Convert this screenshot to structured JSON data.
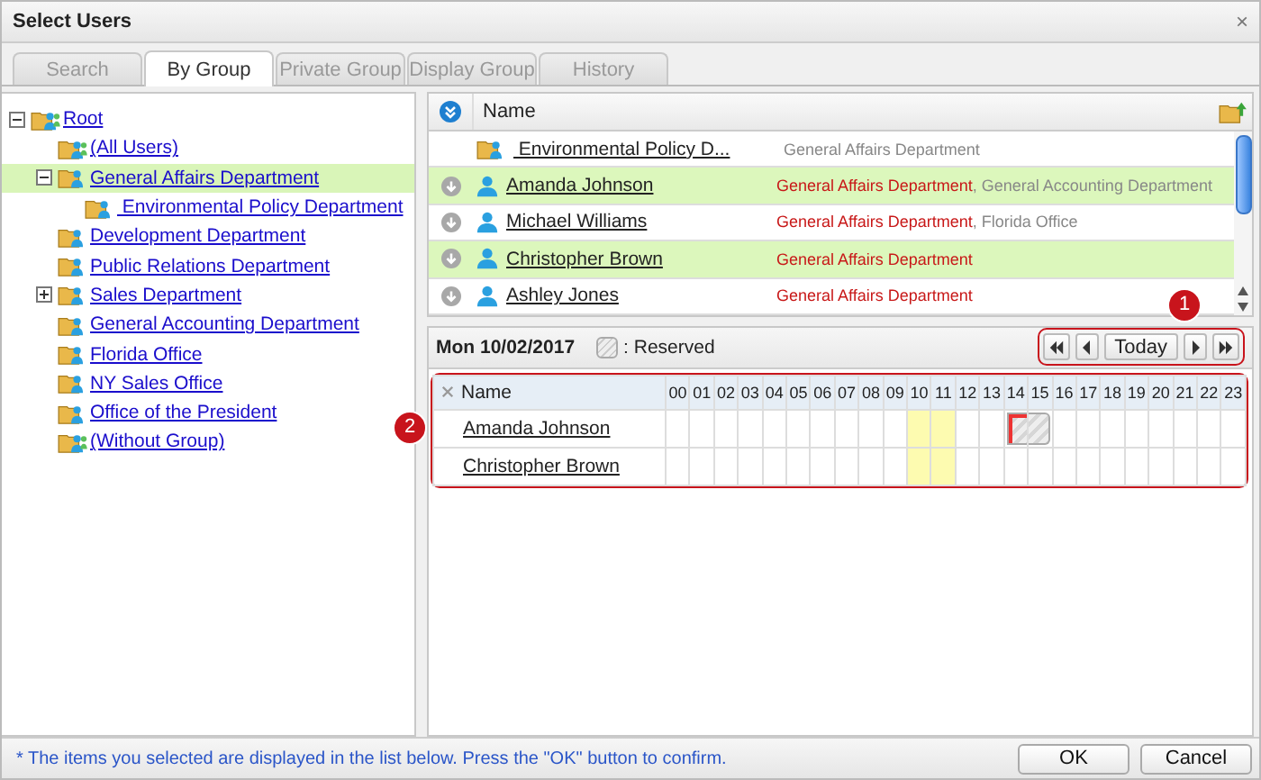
{
  "window": {
    "title": "Select Users",
    "close": "×"
  },
  "tabs": [
    {
      "label": "Search",
      "selected": false
    },
    {
      "label": "By Group",
      "selected": true
    },
    {
      "label": "Private Group",
      "selected": false
    },
    {
      "label": "Display Group",
      "selected": false
    },
    {
      "label": "History",
      "selected": false
    }
  ],
  "tree": [
    {
      "label": "Root",
      "kind": "all",
      "selected": false,
      "expanded": true,
      "children": [
        {
          "label": "(All Users)",
          "kind": "all",
          "selected": false
        },
        {
          "label": "General Affairs Department",
          "kind": "dept",
          "selected": true,
          "expanded": true,
          "children": [
            {
              "label": " Environmental Policy Department",
              "kind": "dept",
              "selected": false
            }
          ]
        },
        {
          "label": "Development Department",
          "kind": "dept",
          "selected": false
        },
        {
          "label": "Public Relations Department",
          "kind": "dept",
          "selected": false
        },
        {
          "label": "Sales Department",
          "kind": "dept",
          "selected": false,
          "expanded": false
        },
        {
          "label": "General Accounting Department",
          "kind": "dept",
          "selected": false
        },
        {
          "label": "Florida Office",
          "kind": "dept",
          "selected": false
        },
        {
          "label": "NY Sales Office",
          "kind": "dept",
          "selected": false
        },
        {
          "label": "Office of the President",
          "kind": "dept",
          "selected": false
        },
        {
          "label": "(Without Group)",
          "kind": "all",
          "selected": false
        }
      ]
    }
  ],
  "users": {
    "column": "Name",
    "rows": [
      {
        "kind": "group",
        "name": " Environmental Policy D...",
        "selected": false,
        "departments": [
          {
            "text": "General Affairs Department",
            "primary": false
          }
        ]
      },
      {
        "kind": "user",
        "name": "Amanda Johnson",
        "selected": true,
        "departments": [
          {
            "text": "General Affairs Department",
            "primary": true
          },
          {
            "text": ", General Accounting Department",
            "primary": false
          }
        ]
      },
      {
        "kind": "user",
        "name": "Michael Williams",
        "selected": false,
        "departments": [
          {
            "text": "General Affairs Department",
            "primary": true
          },
          {
            "text": ", Florida Office",
            "primary": false
          }
        ]
      },
      {
        "kind": "user",
        "name": "Christopher Brown",
        "selected": true,
        "departments": [
          {
            "text": "General Affairs Department",
            "primary": true
          }
        ]
      },
      {
        "kind": "user",
        "name": "Ashley Jones",
        "selected": false,
        "departments": [
          {
            "text": "General Affairs Department",
            "primary": true
          }
        ]
      }
    ]
  },
  "schedule": {
    "date": "Mon 10/02/2017",
    "legend": ": Reserved",
    "today": "Today",
    "callouts": [
      "1",
      "2"
    ],
    "column": "Name",
    "hours": [
      {
        "label": "00",
        "current": false
      },
      {
        "label": "01",
        "current": false
      },
      {
        "label": "02",
        "current": false
      },
      {
        "label": "03",
        "current": false
      },
      {
        "label": "04",
        "current": false
      },
      {
        "label": "05",
        "current": false
      },
      {
        "label": "06",
        "current": false
      },
      {
        "label": "07",
        "current": false
      },
      {
        "label": "08",
        "current": false
      },
      {
        "label": "09",
        "current": false
      },
      {
        "label": "10",
        "current": true
      },
      {
        "label": "11",
        "current": true
      },
      {
        "label": "12",
        "current": false
      },
      {
        "label": "13",
        "current": false
      },
      {
        "label": "14",
        "current": false
      },
      {
        "label": "15",
        "current": false
      },
      {
        "label": "16",
        "current": false
      },
      {
        "label": "17",
        "current": false
      },
      {
        "label": "18",
        "current": false
      },
      {
        "label": "19",
        "current": false
      },
      {
        "label": "20",
        "current": false
      },
      {
        "label": "21",
        "current": false
      },
      {
        "label": "22",
        "current": false
      },
      {
        "label": "23",
        "current": false
      }
    ],
    "rows": [
      {
        "name": "Amanda Johnson",
        "reserved": [
          false,
          false,
          false,
          false,
          false,
          false,
          false,
          false,
          false,
          false,
          false,
          false,
          false,
          false,
          true,
          true,
          false,
          false,
          false,
          false,
          false,
          false,
          false,
          false
        ]
      },
      {
        "name": "Christopher Brown",
        "reserved": [
          false,
          false,
          false,
          false,
          false,
          false,
          false,
          false,
          false,
          false,
          false,
          false,
          false,
          false,
          false,
          false,
          false,
          false,
          false,
          false,
          false,
          false,
          false,
          false
        ]
      }
    ]
  },
  "footer": {
    "note": "* The items you selected are displayed in the list below. Press the \"OK\" button to confirm.",
    "buttons": [
      "OK",
      "Cancel"
    ]
  }
}
